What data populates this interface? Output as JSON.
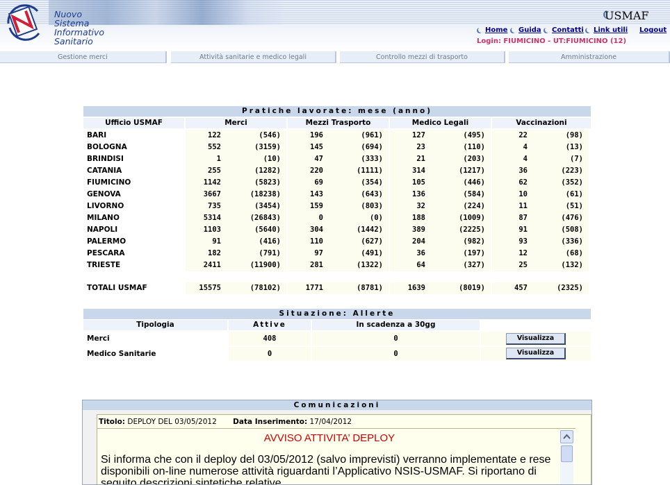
{
  "header": {
    "logo_lines": [
      "Nuovo",
      "Sistema",
      "Informativo",
      "Sanitario"
    ],
    "app_name": "USMAF",
    "links": [
      "Home",
      "Guida",
      "Contatti",
      "Link utili",
      "Logout"
    ],
    "login_text": "Login: FIUMICINO - UT:FIUMICINO (12)"
  },
  "tabs": [
    "Gestione merci",
    "Attività sanitarie e medico legali",
    "Controllo mezzi di trasporto",
    "Amministrazione"
  ],
  "pratiche": {
    "title": "Pratiche lavorate: mese (anno)",
    "headers": [
      "Ufficio USMAF",
      "Merci",
      "Mezzi Trasporto",
      "Medico Legali",
      "Vaccinazioni"
    ],
    "rows": [
      [
        "BARI",
        "122",
        "(546)",
        "196",
        "(961)",
        "127",
        "(495)",
        "22",
        "(98)"
      ],
      [
        "BOLOGNA",
        "552",
        "(3159)",
        "145",
        "(694)",
        "23",
        "(110)",
        "4",
        "(13)"
      ],
      [
        "BRINDISI",
        "1",
        "(10)",
        "47",
        "(333)",
        "21",
        "(203)",
        "4",
        "(7)"
      ],
      [
        "CATANIA",
        "255",
        "(1282)",
        "220",
        "(1111)",
        "314",
        "(1217)",
        "36",
        "(223)"
      ],
      [
        "FIUMICINO",
        "1142",
        "(5823)",
        "69",
        "(354)",
        "105",
        "(446)",
        "62",
        "(352)"
      ],
      [
        "GENOVA",
        "3667",
        "(18238)",
        "143",
        "(643)",
        "136",
        "(584)",
        "10",
        "(61)"
      ],
      [
        "LIVORNO",
        "735",
        "(3454)",
        "159",
        "(803)",
        "32",
        "(224)",
        "11",
        "(51)"
      ],
      [
        "MILANO",
        "5314",
        "(26843)",
        "0",
        "(0)",
        "188",
        "(1009)",
        "87",
        "(476)"
      ],
      [
        "NAPOLI",
        "1103",
        "(5640)",
        "304",
        "(1442)",
        "389",
        "(2225)",
        "91",
        "(508)"
      ],
      [
        "PALERMO",
        "91",
        "(416)",
        "110",
        "(627)",
        "204",
        "(982)",
        "93",
        "(336)"
      ],
      [
        "PESCARA",
        "182",
        "(791)",
        "97",
        "(491)",
        "36",
        "(197)",
        "12",
        "(68)"
      ],
      [
        "TRIESTE",
        "2411",
        "(11900)",
        "281",
        "(1322)",
        "64",
        "(327)",
        "25",
        "(132)"
      ]
    ],
    "totals": [
      "TOTALI USMAF",
      "15575",
      "(78102)",
      "1771",
      "(8781)",
      "1639",
      "(8019)",
      "457",
      "(2325)"
    ]
  },
  "allerte": {
    "title": "Situazione: Allerte",
    "headers": [
      "Tipologia",
      "Attive",
      "In scadenza a 30gg",
      ""
    ],
    "rows": [
      {
        "tipo": "Merci",
        "attive": "408",
        "scadenza": "0",
        "button": "Visualizza"
      },
      {
        "tipo": "Medico Sanitarie",
        "attive": "0",
        "scadenza": "0",
        "button": "Visualizza"
      }
    ]
  },
  "comunicazioni": {
    "title": "Comunicazioni",
    "titolo_label": "Titolo:",
    "titolo_value": "DEPLOY DEL 03/05/2012",
    "data_label": "Data Inserimento:",
    "data_value": "17/04/2012",
    "avviso": "AVVISO ATTIVITA’ DEPLOY",
    "body": "Si informa che con il deploy del 03/05/2012 (salvo imprevisti) verranno implementate e rese disponibili on-line numerose attività riguardanti l’Applicativo NSIS-USMAF. Si riportano di seguito descrizioni sintetiche relative"
  }
}
